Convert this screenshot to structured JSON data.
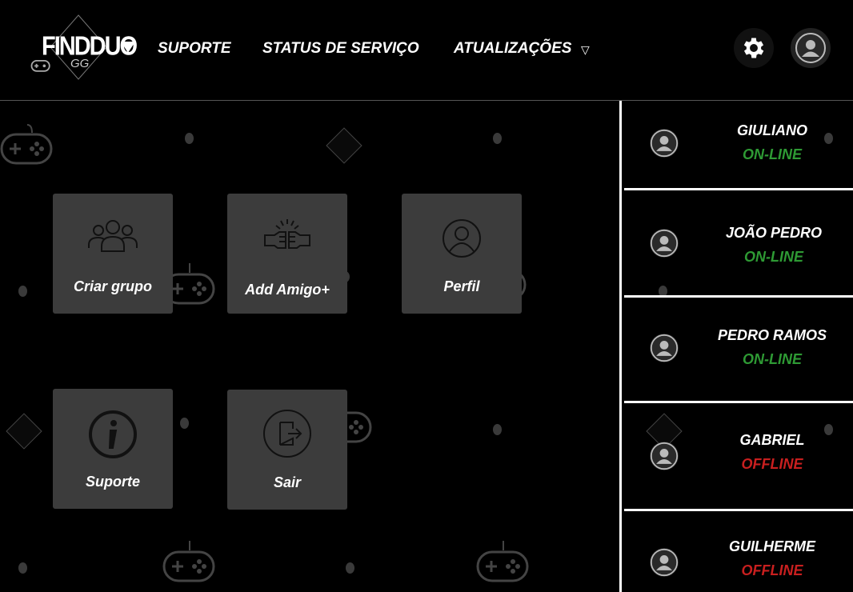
{
  "colors": {
    "background": "#000000",
    "tile": "#3c3c3c",
    "online": "#2e9a34",
    "offline": "#c81f1f"
  },
  "logo": {
    "text": "FINDDUO",
    "sub": "GG",
    "icon": "gamepad-icon"
  },
  "nav": {
    "support": "SUPORTE",
    "status": "STATUS DE SERVIÇO",
    "updates": "ATUALIZAÇÕES",
    "updates_caret": "▽"
  },
  "header_buttons": {
    "settings_icon": "gear-icon",
    "profile_icon": "user-icon"
  },
  "tiles": [
    {
      "label": "Criar grupo",
      "icon": "group-icon"
    },
    {
      "label": "Add Amigo+",
      "icon": "fist-bump-icon"
    },
    {
      "label": "Perfil",
      "icon": "profile-icon"
    },
    {
      "label": "Suporte",
      "icon": "info-icon"
    },
    {
      "label": "Sair",
      "icon": "logout-icon"
    }
  ],
  "friends": [
    {
      "name": "GIULIANO",
      "status": "ON-LINE"
    },
    {
      "name": "JOÃO PEDRO",
      "status": "ON-LINE"
    },
    {
      "name": "PEDRO RAMOS",
      "status": "ON-LINE"
    },
    {
      "name": "GABRIEL",
      "status": "OFFLINE"
    },
    {
      "name": "GUILHERME",
      "status": "OFFLINE"
    }
  ]
}
